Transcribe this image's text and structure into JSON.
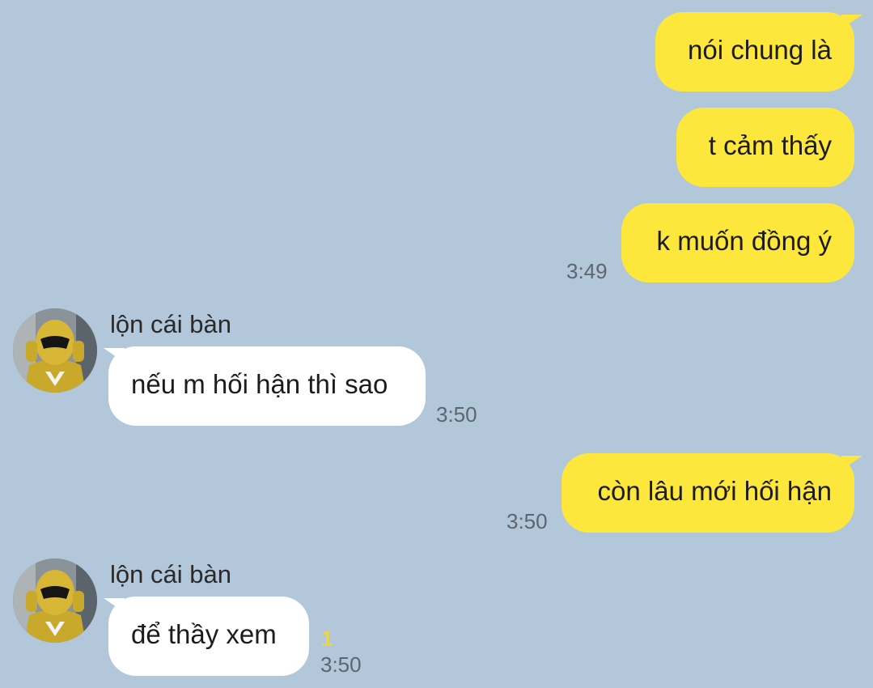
{
  "contact": {
    "name": "lộn cái bàn",
    "avatar_icon": "yellow-ranger-avatar-icon"
  },
  "colors": {
    "background": "#b2c7da",
    "my_bubble": "#fee73c",
    "their_bubble": "#ffffff",
    "unread_count": "#f2d43a"
  },
  "messages": [
    {
      "from": "me",
      "text": "nói chung là"
    },
    {
      "from": "me",
      "text": "t cảm thấy"
    },
    {
      "from": "me",
      "text": "k muốn đồng ý",
      "time": "3:49"
    },
    {
      "from": "contact",
      "sender": "lộn cái bàn",
      "text": "nếu m hối hận thì sao",
      "time": "3:50"
    },
    {
      "from": "me",
      "text": "còn lâu mới hối hận",
      "time": "3:50"
    },
    {
      "from": "contact",
      "sender": "lộn cái bàn",
      "text": "để thầy xem",
      "unread": "1",
      "time": "3:50"
    }
  ]
}
